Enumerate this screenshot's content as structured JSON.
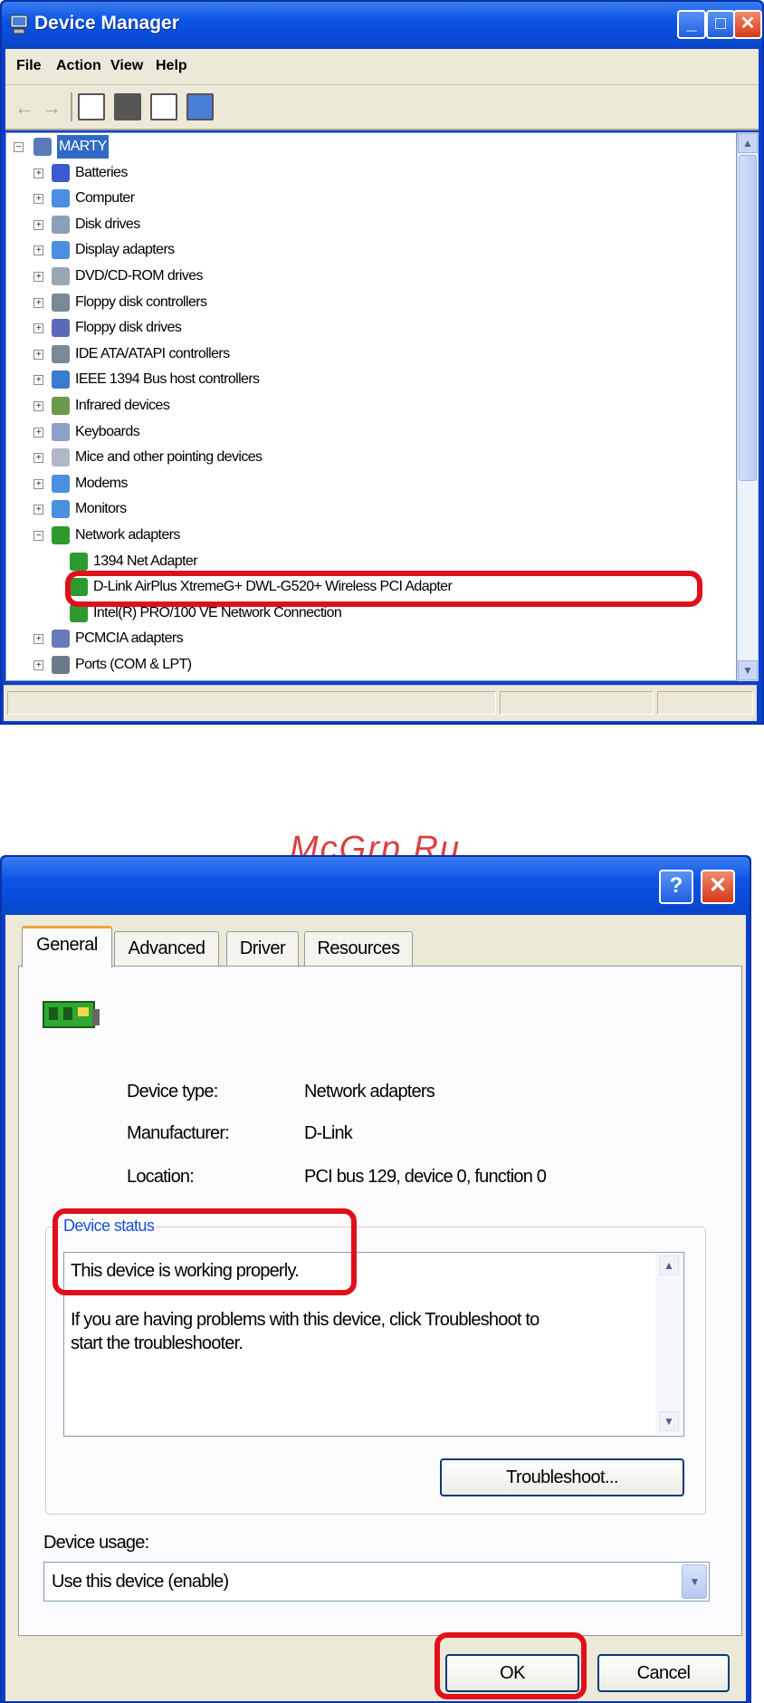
{
  "device_manager": {
    "title": "Device Manager",
    "menu": [
      "File",
      "Action",
      "View",
      "Help"
    ],
    "tree": {
      "root": "MARTY",
      "items": [
        {
          "label": "Batteries",
          "expander": "+",
          "color": "#3a5bd0"
        },
        {
          "label": "Computer",
          "expander": "+",
          "color": "#4a8fe0"
        },
        {
          "label": "Disk drives",
          "expander": "+",
          "color": "#8aa0b8"
        },
        {
          "label": "Display adapters",
          "expander": "+",
          "color": "#4a8fe0"
        },
        {
          "label": "DVD/CD-ROM drives",
          "expander": "+",
          "color": "#9aa6b4"
        },
        {
          "label": "Floppy disk controllers",
          "expander": "+",
          "color": "#7a8898"
        },
        {
          "label": "Floppy disk drives",
          "expander": "+",
          "color": "#5a6ab8"
        },
        {
          "label": "IDE ATA/ATAPI controllers",
          "expander": "+",
          "color": "#7a8898"
        },
        {
          "label": "IEEE 1394 Bus host controllers",
          "expander": "+",
          "color": "#3a7ad0"
        },
        {
          "label": "Infrared devices",
          "expander": "+",
          "color": "#6a9a4a"
        },
        {
          "label": "Keyboards",
          "expander": "+",
          "color": "#8aa0c8"
        },
        {
          "label": "Mice and other pointing devices",
          "expander": "+",
          "color": "#b0b8c8"
        },
        {
          "label": "Modems",
          "expander": "+",
          "color": "#4a8fe0"
        },
        {
          "label": "Monitors",
          "expander": "+",
          "color": "#4a8fe0"
        },
        {
          "label": "Network adapters",
          "expander": "-",
          "color": "#2e9a2e"
        }
      ],
      "network_children": [
        "1394 Net Adapter",
        "D-Link AirPlus XtremeG+ DWL-G520+ Wireless PCI Adapter",
        "Intel(R) PRO/100 VE Network Connection"
      ],
      "after_items": [
        {
          "label": "PCMCIA adapters",
          "expander": "+",
          "color": "#6a7ab8"
        },
        {
          "label": "Ports (COM & LPT)",
          "expander": "+",
          "color": "#6a7a88"
        }
      ]
    }
  },
  "watermark": "McGrp.Ru",
  "properties_dialog": {
    "tabs": [
      "General",
      "Advanced",
      "Driver",
      "Resources"
    ],
    "active_tab": "General",
    "device_type_label": "Device type:",
    "device_type_value": "Network adapters",
    "manufacturer_label": "Manufacturer:",
    "manufacturer_value": "D-Link",
    "location_label": "Location:",
    "location_value": "PCI bus 129, device 0, function 0",
    "status_group_title": "Device status",
    "status_line1": "This device is working properly.",
    "status_line2a": "If you are having problems with this device, click Troubleshoot to",
    "status_line2b": "start the troubleshooter.",
    "troubleshoot_button": "Troubleshoot...",
    "usage_label": "Device usage:",
    "usage_value": "Use this device (enable)",
    "ok_button": "OK",
    "cancel_button": "Cancel"
  },
  "colors": {
    "xp_blue": "#0a54e6",
    "highlight_red": "#e0101a",
    "group_title": "#1a4fd8"
  }
}
